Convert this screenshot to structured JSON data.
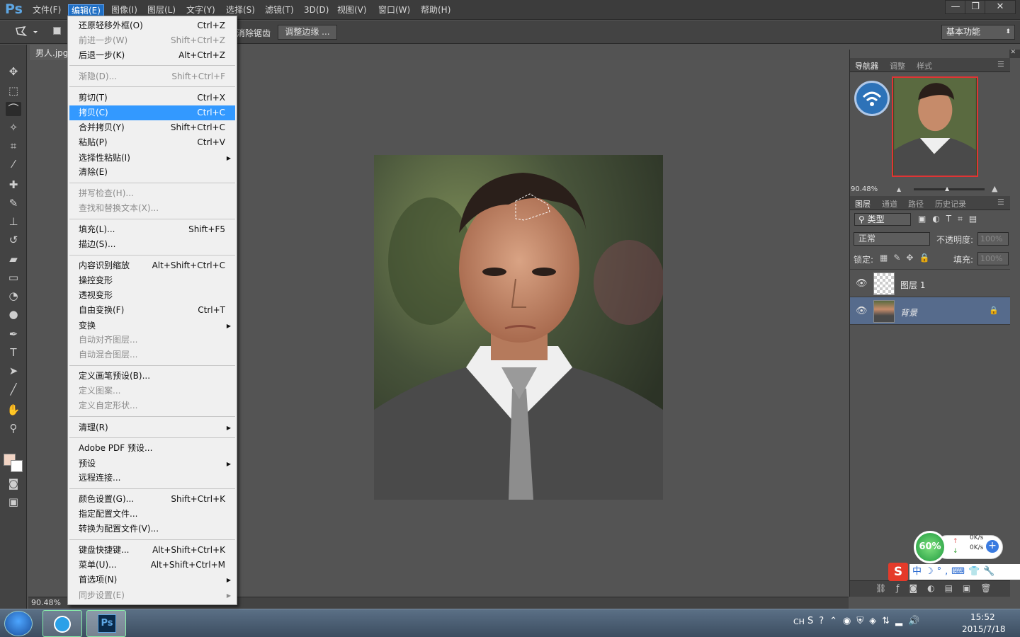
{
  "app": {
    "logo": "Ps"
  },
  "menubar": {
    "items": [
      "文件(F)",
      "编辑(E)",
      "图像(I)",
      "图层(L)",
      "文字(Y)",
      "选择(S)",
      "滤镜(T)",
      "3D(D)",
      "视图(V)",
      "窗口(W)",
      "帮助(H)"
    ],
    "active_index": 1
  },
  "window_controls": {
    "minimize": "—",
    "restore": "❐",
    "close": "✕"
  },
  "options": {
    "antialias_fragment": "消除锯齿",
    "refine_edge": "调整边缘 ...",
    "workspace": "基本功能"
  },
  "document": {
    "tab": "男人.jpg",
    "zoom": "90.48%"
  },
  "edit_menu": {
    "items": [
      {
        "label": "还原轻移外框(O)",
        "shortcut": "Ctrl+Z",
        "disabled": false
      },
      {
        "label": "前进一步(W)",
        "shortcut": "Shift+Ctrl+Z",
        "disabled": true
      },
      {
        "label": "后退一步(K)",
        "shortcut": "Alt+Ctrl+Z",
        "disabled": false
      },
      {
        "label": "渐隐(D)...",
        "shortcut": "Shift+Ctrl+F",
        "disabled": true
      },
      {
        "label": "剪切(T)",
        "shortcut": "Ctrl+X",
        "disabled": false
      },
      {
        "label": "拷贝(C)",
        "shortcut": "Ctrl+C",
        "disabled": false,
        "highlighted": true
      },
      {
        "label": "合并拷贝(Y)",
        "shortcut": "Shift+Ctrl+C",
        "disabled": false
      },
      {
        "label": "粘贴(P)",
        "shortcut": "Ctrl+V",
        "disabled": false
      },
      {
        "label": "选择性粘贴(I)",
        "shortcut": "",
        "submenu": true
      },
      {
        "label": "清除(E)",
        "shortcut": ""
      },
      {
        "label": "拼写检查(H)...",
        "shortcut": "",
        "disabled": true
      },
      {
        "label": "查找和替换文本(X)...",
        "shortcut": "",
        "disabled": true
      },
      {
        "label": "填充(L)...",
        "shortcut": "Shift+F5"
      },
      {
        "label": "描边(S)...",
        "shortcut": ""
      },
      {
        "label": "内容识别缩放",
        "shortcut": "Alt+Shift+Ctrl+C"
      },
      {
        "label": "操控变形",
        "shortcut": ""
      },
      {
        "label": "透视变形",
        "shortcut": ""
      },
      {
        "label": "自由变换(F)",
        "shortcut": "Ctrl+T"
      },
      {
        "label": "变换",
        "shortcut": "",
        "submenu": true
      },
      {
        "label": "自动对齐图层...",
        "shortcut": "",
        "disabled": true
      },
      {
        "label": "自动混合图层...",
        "shortcut": "",
        "disabled": true
      },
      {
        "label": "定义画笔预设(B)...",
        "shortcut": ""
      },
      {
        "label": "定义图案...",
        "shortcut": "",
        "disabled": true
      },
      {
        "label": "定义自定形状...",
        "shortcut": "",
        "disabled": true
      },
      {
        "label": "清理(R)",
        "shortcut": "",
        "submenu": true
      },
      {
        "label": "Adobe PDF 预设...",
        "shortcut": ""
      },
      {
        "label": "预设",
        "shortcut": "",
        "submenu": true
      },
      {
        "label": "远程连接...",
        "shortcut": ""
      },
      {
        "label": "颜色设置(G)...",
        "shortcut": "Shift+Ctrl+K"
      },
      {
        "label": "指定配置文件...",
        "shortcut": ""
      },
      {
        "label": "转换为配置文件(V)...",
        "shortcut": ""
      },
      {
        "label": "键盘快捷键...",
        "shortcut": "Alt+Shift+Ctrl+K"
      },
      {
        "label": "菜单(U)...",
        "shortcut": "Alt+Shift+Ctrl+M"
      },
      {
        "label": "首选项(N)",
        "shortcut": "",
        "submenu": true
      },
      {
        "label": "同步设置(E)",
        "shortcut": "",
        "submenu": true,
        "disabled": true
      }
    ]
  },
  "navigator": {
    "tabs": [
      "导航器",
      "调整",
      "样式"
    ],
    "zoom": "90.48%"
  },
  "layers_panel": {
    "tabs": [
      "图层",
      "通道",
      "路径",
      "历史记录"
    ],
    "filter": "类型",
    "blend_mode": "正常",
    "opacity_label": "不透明度:",
    "opacity": "100%",
    "lock_label": "锁定:",
    "fill_label": "填充:",
    "fill": "100%",
    "layers": [
      {
        "name": "图层 1",
        "selected": false
      },
      {
        "name": "背景",
        "selected": true,
        "locked": true
      }
    ]
  },
  "net_widget": {
    "percent": "60%",
    "upload": "0K/s",
    "download": "0K/s"
  },
  "taskbar": {
    "lang": "CH",
    "time": "15:52",
    "date": "2015/7/18"
  },
  "colors": {
    "accent": "#3399ff",
    "ui_dark": "#3c3c3c",
    "canvas": "#535353",
    "selection_border": "#e03434"
  }
}
